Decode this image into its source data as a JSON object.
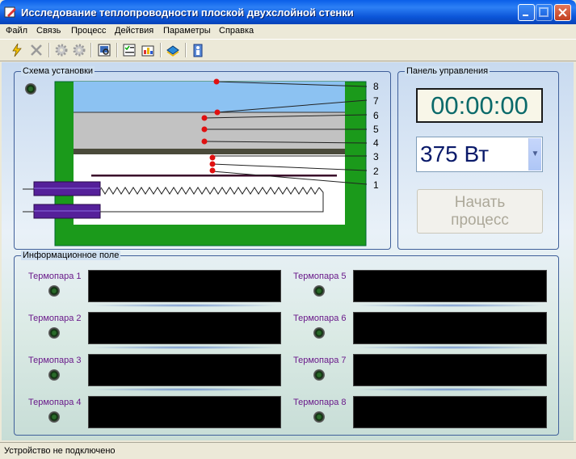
{
  "window": {
    "title": "Исследование теплопроводности плоской двухслойной стенки"
  },
  "menu": [
    "Файл",
    "Связь",
    "Процесс",
    "Действия",
    "Параметры",
    "Справка"
  ],
  "toolbar": {
    "tools": [
      "connect-icon",
      "disconnect-icon",
      "gear-start-icon",
      "gear-stop-icon",
      "report-icon",
      "checklist-icon",
      "chart-icon",
      "book-icon",
      "exit-icon"
    ]
  },
  "scheme": {
    "label": "Схема установки",
    "point_labels": [
      "8",
      "7",
      "6",
      "5",
      "4",
      "3",
      "2",
      "1"
    ]
  },
  "control": {
    "label": "Панель управления",
    "timer": "00:00:00",
    "power": "375 Вт",
    "start_line1": "Начать",
    "start_line2": "процесс"
  },
  "info": {
    "label": "Информационное поле",
    "thermocouples": [
      "Термопара 1",
      "Термопара 2",
      "Термопара 3",
      "Термопара 4",
      "Термопара 5",
      "Термопара 6",
      "Термопара 7",
      "Термопара 8"
    ]
  },
  "status": {
    "text": "Устройство не подключено"
  }
}
